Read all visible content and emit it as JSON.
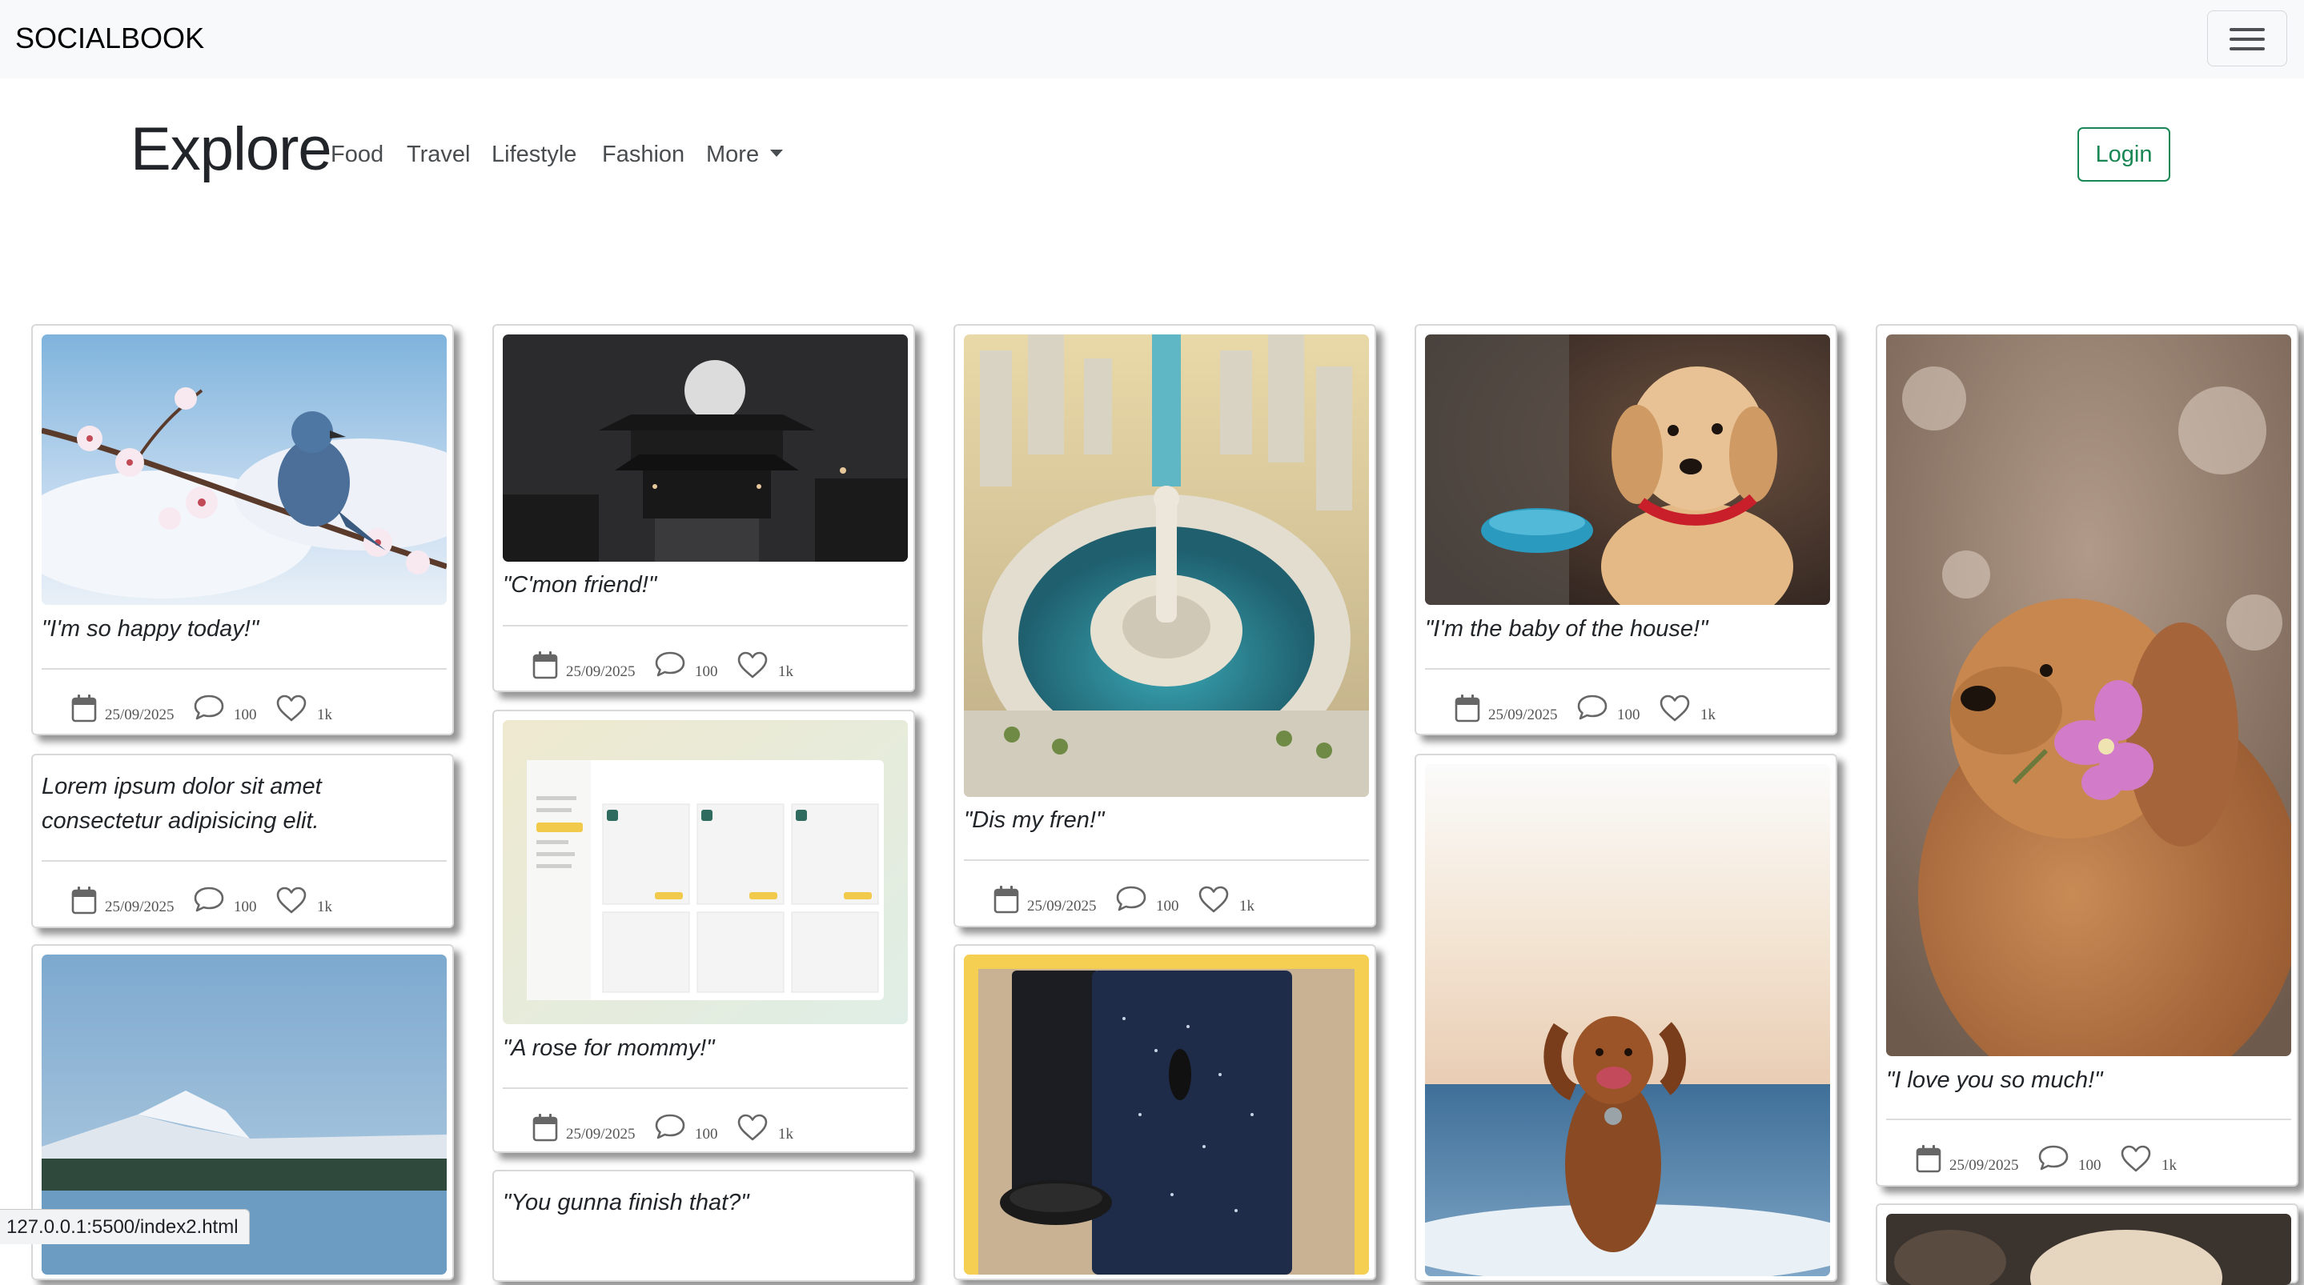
{
  "navbar": {
    "brand": "SOCIALBOOK"
  },
  "header": {
    "title": "Explore",
    "nav_links": [
      "Food",
      "Travel",
      "Lifestyle",
      "Fashion",
      "More"
    ],
    "login_label": "Login"
  },
  "posts": [
    {
      "caption": "\"I'm so happy today!\"",
      "date": "25/09/2025",
      "comments": "100",
      "likes": "1k"
    },
    {
      "caption": "Lorem ipsum dolor sit amet consectetur adipisicing elit.",
      "date": "25/09/2025",
      "comments": "100",
      "likes": "1k"
    },
    {
      "caption": "\"C'mon friend!\"",
      "date": "25/09/2025",
      "comments": "100",
      "likes": "1k"
    },
    {
      "caption": "\"A rose for mommy!\"",
      "date": "25/09/2025",
      "comments": "100",
      "likes": "1k"
    },
    {
      "caption": "\"You gunna finish that?\""
    },
    {
      "caption": "\"Dis my fren!\"",
      "date": "25/09/2025",
      "comments": "100",
      "likes": "1k"
    },
    {
      "caption": "\"I'm the baby of the house!\"",
      "date": "25/09/2025",
      "comments": "100",
      "likes": "1k"
    },
    {
      "caption": "\"I love you so much!\"",
      "date": "25/09/2025",
      "comments": "100",
      "likes": "1k"
    }
  ],
  "photos": {
    "bird_on_blossom": "blue bird on cherry blossom branch",
    "moon_temple": "temple under full moon",
    "dashboard_screenshot": "orders dashboard screenshot",
    "fountain_city": "futuristic city with fountain",
    "puppy_red_collar": "puppy with red collar",
    "dog_with_flower": "dog holding pink flower",
    "dog_on_beach": "dog running on beach",
    "outfit_flatlay": "outfit flat lay",
    "lake_mountain": "lake and mountain"
  },
  "status_bar": {
    "url": "127.0.0.1:5500/index2.html"
  },
  "colors": {
    "navbar_bg": "#f8f9fa",
    "login_accent": "#198754",
    "page_bg": "#ffffff"
  }
}
